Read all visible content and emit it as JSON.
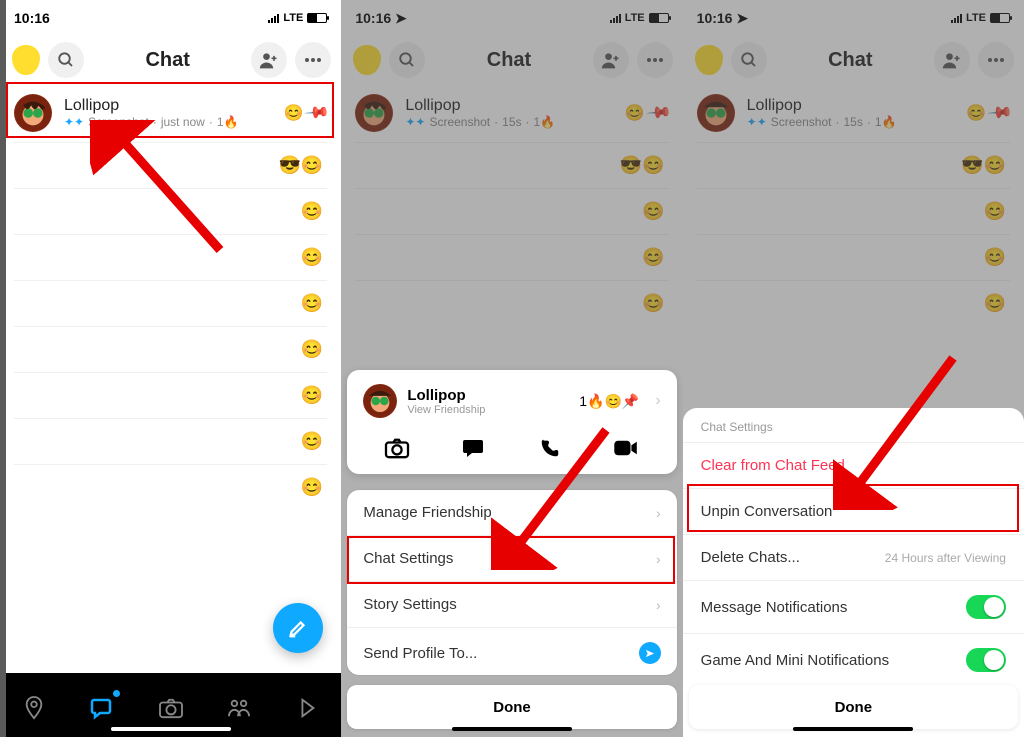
{
  "status": {
    "time": "10:16",
    "lte": "LTE"
  },
  "header": {
    "title": "Chat"
  },
  "chat": {
    "name": "Lollipop",
    "sub_action": "Screenshot",
    "sub_time_now": "just now",
    "sub_time_15s": "15s",
    "streak": "1🔥",
    "emoji_smiley": "😊",
    "pin": "📌",
    "view_friendship": "View Friendship",
    "badge": "1🔥😊📌"
  },
  "empty_rows": [
    "😎😊",
    "😊",
    "😊",
    "😊",
    "😊",
    "😊",
    "😊",
    "😊"
  ],
  "card_options": {
    "manage": "Manage Friendship",
    "chat_settings": "Chat Settings",
    "story_settings": "Story Settings",
    "send_profile": "Send Profile To..."
  },
  "settings": {
    "title": "Chat Settings",
    "clear": "Clear from Chat Feed",
    "unpin": "Unpin Conversation",
    "delete": "Delete Chats...",
    "delete_sub": "24 Hours after Viewing",
    "msg_notif": "Message Notifications",
    "game_notif": "Game And Mini Notifications"
  },
  "done": "Done"
}
